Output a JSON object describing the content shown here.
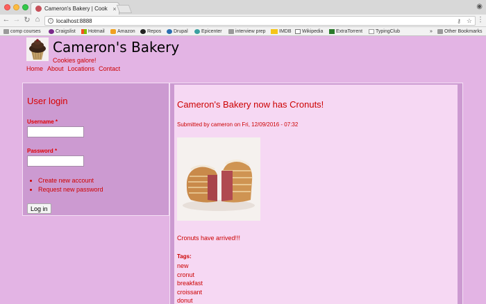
{
  "browser": {
    "tab_title": "Cameron's Bakery | Cookies ga...",
    "tab_close": "×",
    "url": "localhost:8888",
    "bookmarks": [
      {
        "label": "comp courses",
        "icon": "folder-icon"
      },
      {
        "label": "Craigslist",
        "icon": "craigslist-icon"
      },
      {
        "label": "Hotmail",
        "icon": "hotmail-icon"
      },
      {
        "label": "Amazon",
        "icon": "amazon-icon"
      },
      {
        "label": "Repos",
        "icon": "github-icon"
      },
      {
        "label": "Drupal",
        "icon": "drupal-icon"
      },
      {
        "label": "Epicenter",
        "icon": "epicenter-icon"
      },
      {
        "label": "interview prep",
        "icon": "folder-icon"
      },
      {
        "label": "IMDB",
        "icon": "imdb-icon"
      },
      {
        "label": "Wikipedia",
        "icon": "wikipedia-icon"
      },
      {
        "label": "ExtraTorrent",
        "icon": "extratorrent-icon"
      },
      {
        "label": "TypingClub",
        "icon": "page-icon"
      }
    ],
    "overflow": "»",
    "other_bookmarks": "Other Bookmarks"
  },
  "site": {
    "name": "Cameron's Bakery",
    "slogan": "Cookies galore!",
    "menu": [
      "Home",
      "About",
      "Locations",
      "Contact"
    ]
  },
  "login": {
    "title": "User login",
    "username_label": "Username *",
    "password_label": "Password *",
    "links": [
      "Create new account",
      "Request new password"
    ],
    "button": "Log in"
  },
  "node": {
    "title": "Cameron's Bakery now has Cronuts!",
    "submitted": "Submitted by cameron on Fri, 12/09/2016 - 07:32",
    "body": "Cronuts have arrived!!!",
    "tags_label": "Tags:",
    "tags": [
      "new",
      "cronut",
      "breakfast",
      "croissant",
      "donut"
    ]
  },
  "colors": {
    "page_bg": "#e3b4e4",
    "sidebar_bg": "#cc9ad1",
    "content_bg": "#f6d8f3",
    "accent": "#cc0000"
  }
}
